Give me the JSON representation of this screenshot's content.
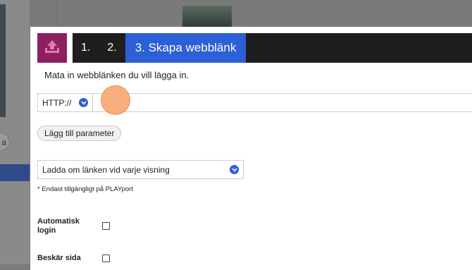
{
  "background": {
    "pill_text": "a"
  },
  "wizard": {
    "steps": [
      {
        "label": "1."
      },
      {
        "label": "2."
      },
      {
        "label": "3. Skapa webblänk"
      }
    ],
    "instruction": "Mata in webblänken du vill lägga in.",
    "protocol": {
      "value": "HTTP://"
    },
    "url_input": {
      "value": "",
      "placeholder": ""
    },
    "add_parameter_label": "Lägg till parameter",
    "reload_select": {
      "value": "Ladda om länken vid varje visning"
    },
    "note": "* Endast tillgängligt på PLAYport",
    "checkboxes": [
      {
        "label": "Automatisk login",
        "checked": false
      },
      {
        "label": "Beskär sida",
        "checked": false
      }
    ]
  },
  "colors": {
    "upload_tile": "#8d2061",
    "active_step": "#2d5fd6",
    "steps_bar": "#1e1e1e",
    "cursor_highlight": "#f7a066"
  },
  "icons": {
    "upload": "upload-icon",
    "dropdown": "chevron-down-icon"
  }
}
